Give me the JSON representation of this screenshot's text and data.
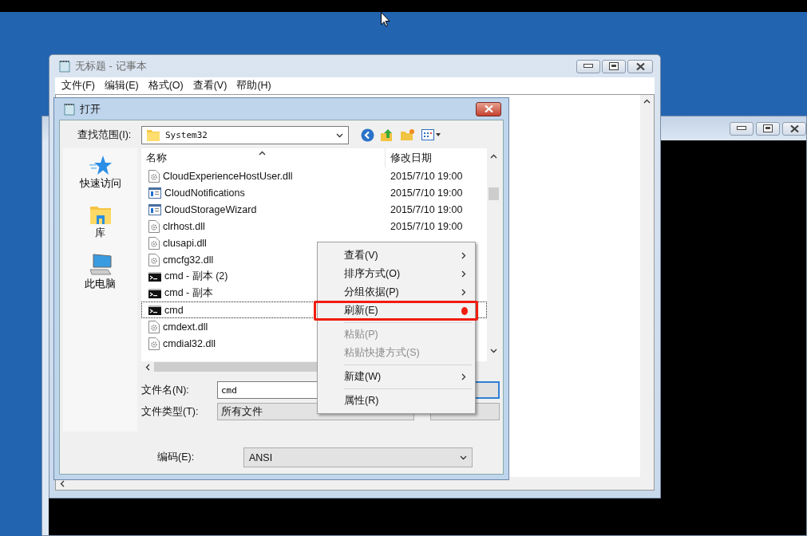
{
  "notepad": {
    "title": "无标题 - 记事本",
    "menu": [
      "文件(F)",
      "编辑(E)",
      "格式(O)",
      "查看(V)",
      "帮助(H)"
    ]
  },
  "dialog": {
    "title": "打开",
    "look_in_label": "查找范围(I):",
    "look_in_value": "System32",
    "places": [
      {
        "kind": "star",
        "label": "快速访问"
      },
      {
        "kind": "library",
        "label": "库"
      },
      {
        "kind": "computer",
        "label": "此电脑"
      }
    ],
    "columns": [
      "名称",
      "修改日期"
    ],
    "files": [
      {
        "kind": "dll",
        "name": "CloudExperienceHostUser.dll",
        "modified": "2015/7/10 19:00",
        "selected": false
      },
      {
        "kind": "app",
        "name": "CloudNotifications",
        "modified": "2015/7/10 19:00",
        "selected": false
      },
      {
        "kind": "app",
        "name": "CloudStorageWizard",
        "modified": "2015/7/10 19:00",
        "selected": false
      },
      {
        "kind": "dll",
        "name": "clrhost.dll",
        "modified": "2015/7/10 19:00",
        "selected": false
      },
      {
        "kind": "dll",
        "name": "clusapi.dll",
        "selected": false
      },
      {
        "kind": "dll",
        "name": "cmcfg32.dll",
        "selected": false
      },
      {
        "kind": "console",
        "name": "cmd - 副本 (2)",
        "selected": false
      },
      {
        "kind": "console",
        "name": "cmd - 副本",
        "selected": false
      },
      {
        "kind": "console",
        "name": "cmd",
        "selected": true
      },
      {
        "kind": "dll",
        "name": "cmdext.dll",
        "selected": false
      },
      {
        "kind": "dll",
        "name": "cmdial32.dll",
        "selected": false
      }
    ],
    "filename_label": "文件名(N):",
    "filename_value": "cmd",
    "filetype_label": "文件类型(T):",
    "filetype_value": "所有文件",
    "encoding_label": "编码(E):",
    "encoding_value": "ANSI"
  },
  "context_menu": {
    "items": [
      {
        "kind": "item",
        "label": "查看(V)",
        "submenu": true,
        "disabled": false,
        "annotated": false
      },
      {
        "kind": "item",
        "label": "排序方式(O)",
        "submenu": true,
        "disabled": false,
        "annotated": false
      },
      {
        "kind": "item",
        "label": "分组依据(P)",
        "submenu": true,
        "disabled": false,
        "annotated": false
      },
      {
        "kind": "item",
        "label": "刷新(E)",
        "submenu": false,
        "disabled": false,
        "annotated": true
      },
      {
        "kind": "separator"
      },
      {
        "kind": "item",
        "label": "粘贴(P)",
        "submenu": false,
        "disabled": true,
        "annotated": false
      },
      {
        "kind": "item",
        "label": "粘贴快捷方式(S)",
        "submenu": false,
        "disabled": true,
        "annotated": false
      },
      {
        "kind": "separator"
      },
      {
        "kind": "item",
        "label": "新建(W)",
        "submenu": true,
        "disabled": false,
        "annotated": false
      },
      {
        "kind": "separator"
      },
      {
        "kind": "item",
        "label": "属性(R)",
        "submenu": false,
        "disabled": false,
        "annotated": false
      }
    ]
  }
}
